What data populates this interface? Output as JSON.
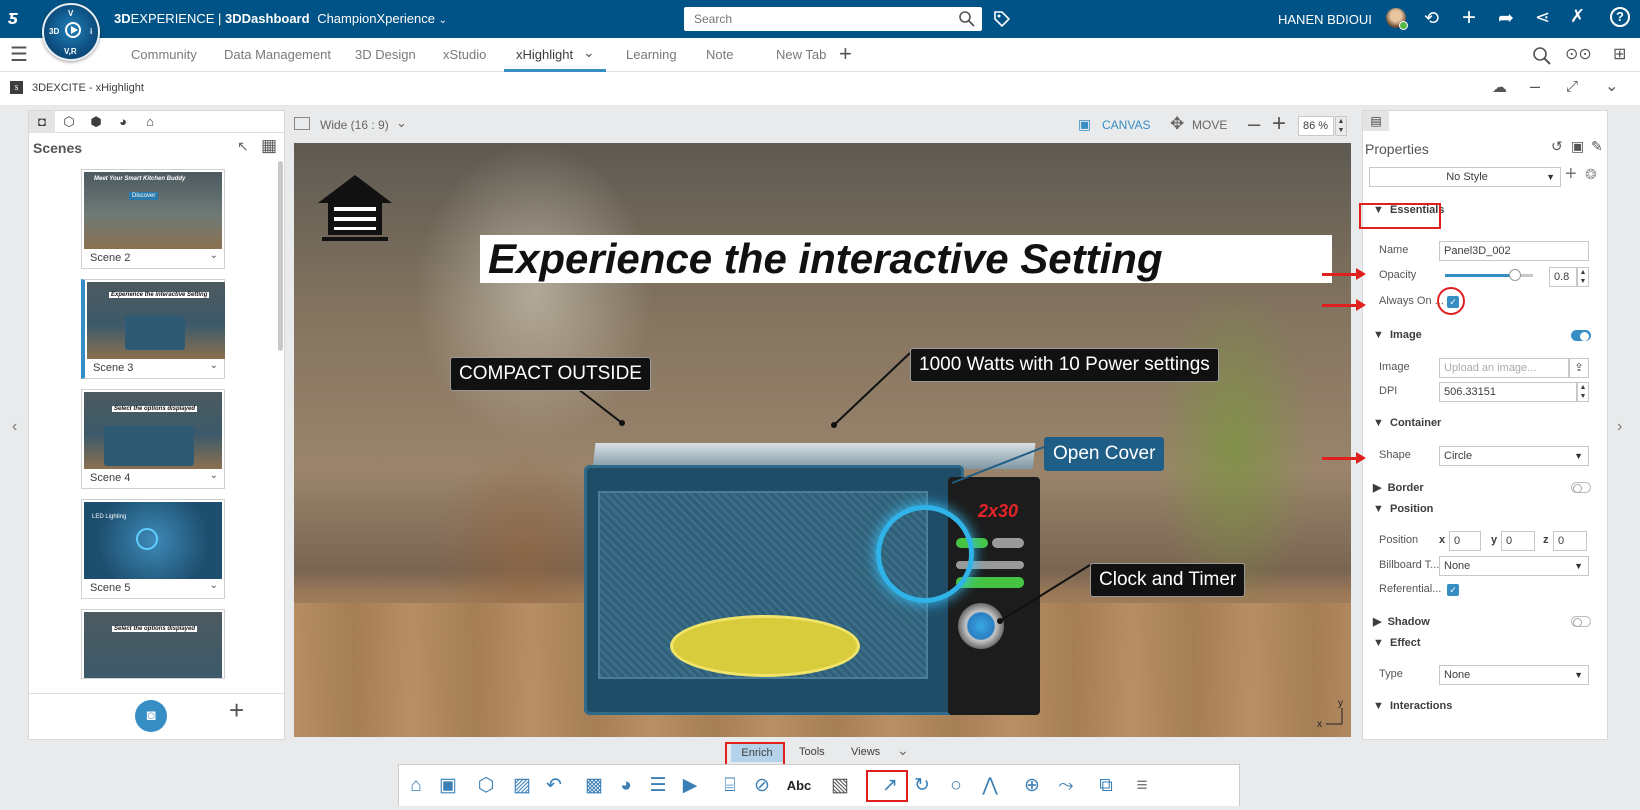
{
  "topbar": {
    "brand_bold": "3D",
    "brand": "EXPERIENCE | ",
    "dashboard_bold": "3DDashboard",
    "dashboard_name": "ChampionXperience",
    "compass": {
      "top": "V",
      "left": "3D",
      "right": "i",
      "bottom": "V,R"
    },
    "search_placeholder": "Search",
    "user": "HANEN BDIOUI"
  },
  "tabs": [
    "Community",
    "Data Management",
    "3D Design",
    "xStudio",
    "xHighlight",
    "Learning",
    "Note",
    "New Tab"
  ],
  "active_tab": "xHighlight",
  "app": {
    "title": "3DEXCITE - xHighlight"
  },
  "scenes_panel": {
    "title": "Scenes",
    "items": [
      {
        "label": "Scene 2",
        "caption": "Meet Your Smart Kitchen Buddy",
        "sub": "Discover"
      },
      {
        "label": "Scene 3",
        "caption": "Experience the interactive Setting",
        "sub": ""
      },
      {
        "label": "Scene 4",
        "caption": "Select the options displayed",
        "sub": ""
      },
      {
        "label": "Scene 5",
        "caption": "",
        "sub": "LED Lighting"
      },
      {
        "label": "",
        "caption": "Select the options displayed",
        "sub": ""
      }
    ]
  },
  "canvas_bar": {
    "aspect": "Wide (16 : 9)",
    "canvas": "CANVAS",
    "move": "MOVE",
    "zoom": "86 %"
  },
  "scene": {
    "headline": "Experience the interactive Setting",
    "callouts": {
      "compact": "COMPACT OUTSIDE",
      "watts": "1000 Watts with 10 Power settings",
      "cover": "Open Cover",
      "clock": "Clock and Timer"
    },
    "oven_logo": "2x30",
    "axis_y": "y",
    "axis_x": "x"
  },
  "properties": {
    "title": "Properties",
    "style": "No Style",
    "essentials": "Essentials",
    "name_label": "Name",
    "name_value": "Panel3D_002",
    "opacity_label": "Opacity",
    "opacity_value": "0.8",
    "always_on_label": "Always On ...",
    "image_section": "Image",
    "image_label": "Image",
    "image_placeholder": "Upload an image...",
    "dpi_label": "DPI",
    "dpi_value": "506.33151",
    "container_section": "Container",
    "shape_label": "Shape",
    "shape_value": "Circle",
    "border_section": "Border",
    "position_section": "Position",
    "position_label": "Position",
    "pos_x_label": "x",
    "pos_x": "0",
    "pos_y_label": "y",
    "pos_y": "0",
    "pos_z_label": "z",
    "pos_z": "0",
    "billboard_label": "Billboard T...",
    "billboard_value": "None",
    "referential_label": "Referential...",
    "shadow_section": "Shadow",
    "effect_section": "Effect",
    "type_label": "Type",
    "type_value": "None",
    "interactions_section": "Interactions"
  },
  "bottom": {
    "tabs": [
      "Enrich",
      "Tools",
      "Views"
    ],
    "active": "Enrich",
    "abc": "Abc"
  },
  "colors": {
    "topbar": "#005386",
    "accent": "#368ec4",
    "highlight": "#e0201f"
  }
}
